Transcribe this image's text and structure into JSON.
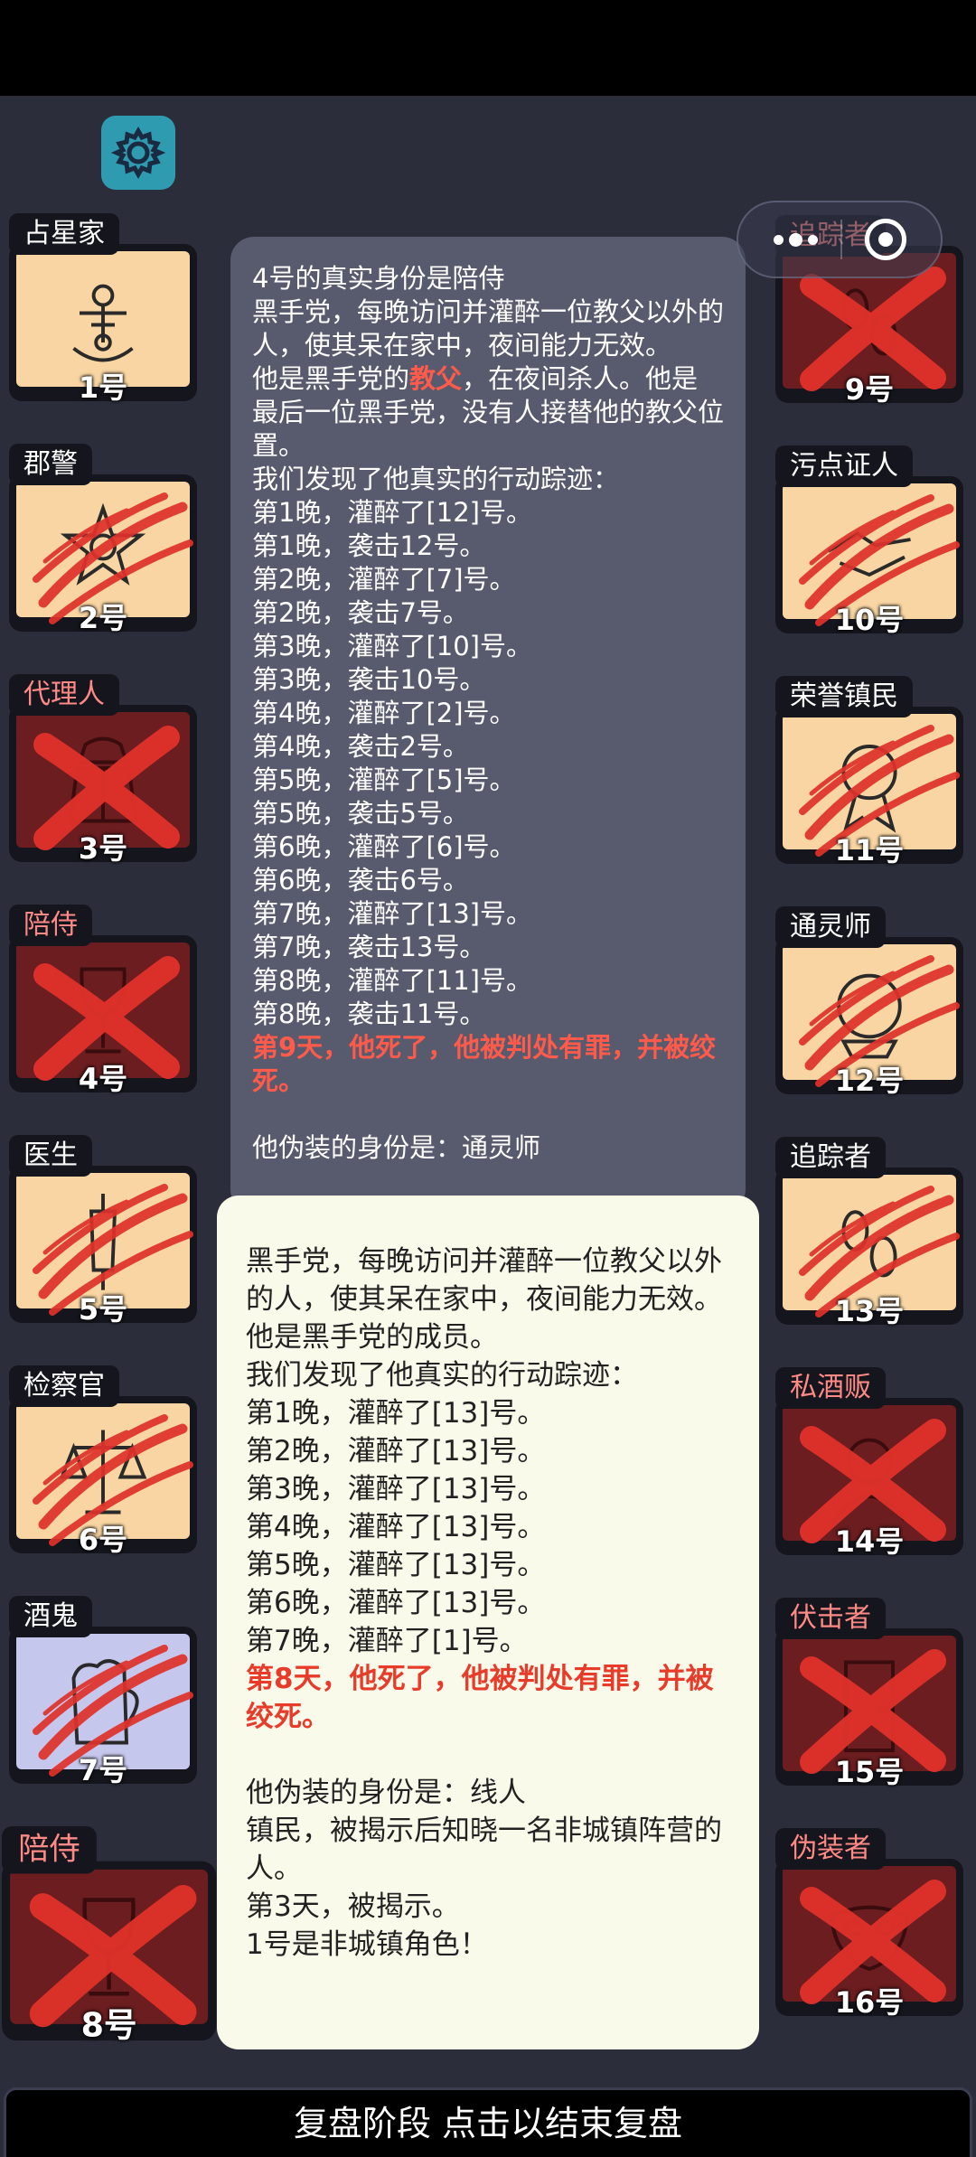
{
  "colors": {
    "background": "#2b2d3b",
    "card": "#f8d5a2",
    "dead_card": "#6b1d1f",
    "slash": "#e0322a",
    "panel_dark": "#585b6e",
    "panel_light": "#fafaea",
    "highlight": "#ff5a4a"
  },
  "left_cards": [
    {
      "role": "占星家",
      "num": "1号",
      "icon": "sextant-icon",
      "status": "alive"
    },
    {
      "role": "郡警",
      "num": "2号",
      "icon": "sheriff-badge-icon",
      "status": "slashed"
    },
    {
      "role": "代理人",
      "num": "3号",
      "icon": "agent-coat-icon",
      "status": "crossed"
    },
    {
      "role": "陪侍",
      "num": "4号",
      "icon": "wine-glass-icon",
      "status": "crossed"
    },
    {
      "role": "医生",
      "num": "5号",
      "icon": "syringe-icon",
      "status": "slashed"
    },
    {
      "role": "检察官",
      "num": "6号",
      "icon": "scales-emblem-icon",
      "status": "slashed"
    },
    {
      "role": "酒鬼",
      "num": "7号",
      "icon": "beer-mug-icon",
      "status": "slashed"
    },
    {
      "role": "陪侍",
      "num": "8号",
      "icon": "wine-glass-icon",
      "status": "crossed"
    }
  ],
  "right_cards": [
    {
      "role": "追踪者",
      "num": "9号",
      "icon": "footprint-icon",
      "status": "crossed"
    },
    {
      "role": "污点证人",
      "num": "10号",
      "icon": "handshake-icon",
      "status": "slashed"
    },
    {
      "role": "荣誉镇民",
      "num": "11号",
      "icon": "medal-icon",
      "status": "slashed"
    },
    {
      "role": "通灵师",
      "num": "12号",
      "icon": "crystal-ball-icon",
      "status": "slashed"
    },
    {
      "role": "追踪者",
      "num": "13号",
      "icon": "footprint-icon",
      "status": "slashed"
    },
    {
      "role": "私酒贩",
      "num": "14号",
      "icon": "bootlegger-icon",
      "status": "crossed"
    },
    {
      "role": "伏击者",
      "num": "15号",
      "icon": "door-icon",
      "status": "crossed"
    },
    {
      "role": "伪装者",
      "num": "16号",
      "icon": "mask-icon",
      "status": "crossed"
    }
  ],
  "panel1": {
    "title": "4号的真实身份是陪侍",
    "desc": "黑手党，每晚访问并灌醉一位教父以外的人，使其呆在家中，夜间能力无效。",
    "godfather_prefix": "他是黑手党的",
    "godfather_word": "教父",
    "godfather_suffix": "，在夜间杀人。他是最后一位黑手党，没有人接替他的教父位置。",
    "found": "我们发现了他真实的行动踪迹：",
    "log": [
      "第1晚，灌醉了[12]号。",
      "第1晚，袭击12号。",
      "第2晚，灌醉了[7]号。",
      "第2晚，袭击7号。",
      "第3晚，灌醉了[10]号。",
      "第3晚，袭击10号。",
      "第4晚，灌醉了[2]号。",
      "第4晚，袭击2号。",
      "第5晚，灌醉了[5]号。",
      "第5晚，袭击5号。",
      "第6晚，灌醉了[6]号。",
      "第6晚，袭击6号。",
      "第7晚，灌醉了[13]号。",
      "第7晚，袭击13号。",
      "第8晚，灌醉了[11]号。",
      "第8晚，袭击11号。"
    ],
    "death": "第9天，他死了，他被判处有罪，并被绞死。",
    "disguise": "他伪装的身份是：通灵师"
  },
  "panel2": {
    "desc": "黑手党，每晚访问并灌醉一位教父以外的人，使其呆在家中，夜间能力无效。",
    "member": "他是黑手党的成员。",
    "found": "我们发现了他真实的行动踪迹：",
    "log": [
      "第1晚，灌醉了[13]号。",
      "第2晚，灌醉了[13]号。",
      "第3晚，灌醉了[13]号。",
      "第4晚，灌醉了[13]号。",
      "第5晚，灌醉了[13]号。",
      "第6晚，灌醉了[13]号。",
      "第7晚，灌醉了[1]号。"
    ],
    "death": "第8天，他死了，他被判处有罪，并被绞死。",
    "disguise": "他伪装的身份是：线人",
    "disguise_desc": "镇民，被揭示后知晓一名非城镇阵营的人。",
    "revealed": "第3天，被揭示。",
    "note": "1号是非城镇角色！"
  },
  "bottom_bar": "复盘阶段 点击以结束复盘"
}
